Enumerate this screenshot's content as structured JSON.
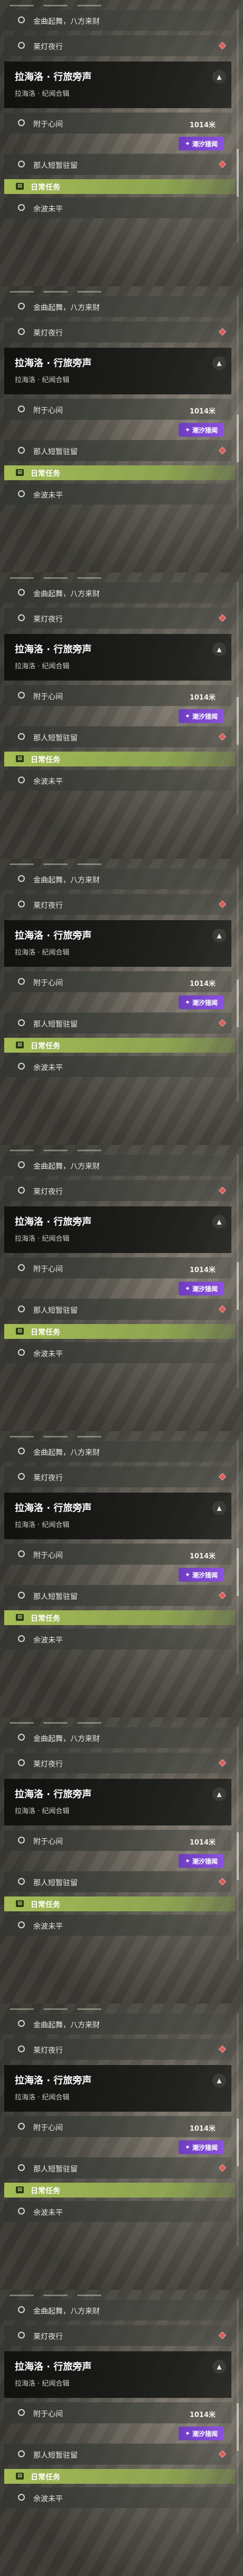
{
  "frames_count": 9,
  "frames": [
    {
      "scroll_thumb_fraction": 0.75
    },
    {
      "scroll_thumb_fraction": 0.64
    },
    {
      "scroll_thumb_fraction": 0.62
    },
    {
      "scroll_thumb_fraction": 0.6
    },
    {
      "scroll_thumb_fraction": 0.58
    },
    {
      "scroll_thumb_fraction": 0.58
    },
    {
      "scroll_thumb_fraction": 0.57
    },
    {
      "scroll_thumb_fraction": 0.57
    },
    {
      "scroll_thumb_fraction": 0.56
    }
  ],
  "quest": {
    "item_gold": "金曲起舞，八方来财",
    "item_lantern": "莱灯夜行",
    "title": "拉海洛 · 行旅旁声",
    "subtitle": "拉海洛 · 纪闻合辑",
    "item_heart": "附于心间",
    "distance": "1014米",
    "tide_label": "潮汐猎闻",
    "item_alley": "那人短暂驻留",
    "daily_label": "日常任务",
    "item_moon": "余波未平"
  },
  "icons": {
    "collapse": "chevron-up-icon",
    "marker": "map-marker-icon",
    "daily": "daily-task-icon"
  },
  "colors": {
    "accent_green": "#a9c458",
    "tide_purple": "#7e46d3",
    "marker_red": "#d85f5a"
  }
}
